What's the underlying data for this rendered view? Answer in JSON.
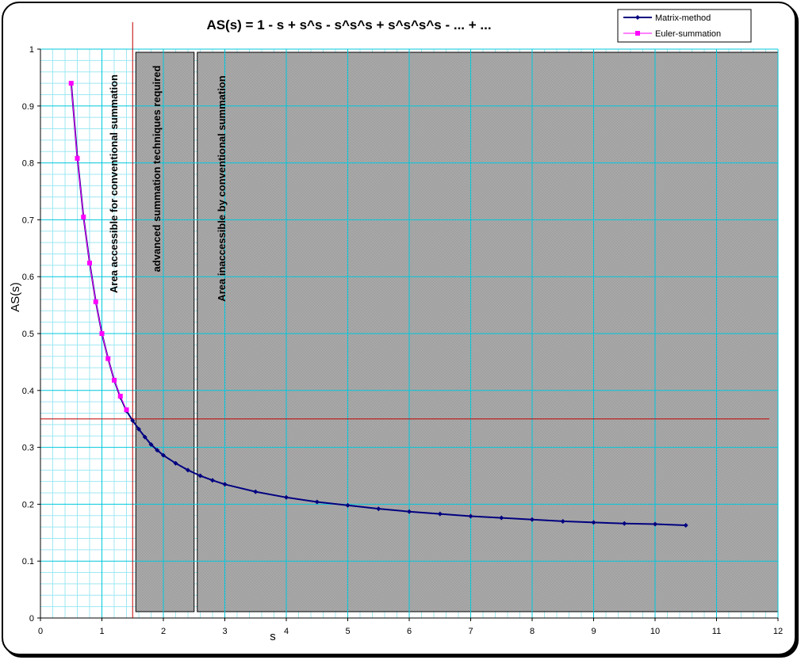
{
  "chart_data": {
    "type": "line",
    "title": "AS(s) = 1 - s + s^s - s^s^s + s^s^s^s - ... + ...",
    "xlabel": "s",
    "ylabel": "AS(s)",
    "xlim": [
      0,
      12
    ],
    "ylim": [
      0,
      1
    ],
    "x_ticks": [
      "0",
      "1",
      "2",
      "3",
      "4",
      "5",
      "6",
      "7",
      "8",
      "9",
      "10",
      "11",
      "12"
    ],
    "y_ticks": [
      "0",
      "0.1",
      "0.2",
      "0.3",
      "0.4",
      "0.5",
      "0.6",
      "0.7",
      "0.8",
      "0.9",
      "1"
    ],
    "grid": true,
    "legend_position": "top-right",
    "series": [
      {
        "name": "Matrix-method",
        "color": "#000080",
        "marker": "diamond",
        "x": [
          0.5,
          0.6,
          0.7,
          0.8,
          0.9,
          1.0,
          1.1,
          1.2,
          1.3,
          1.4,
          1.5,
          1.6,
          1.7,
          1.8,
          1.9,
          2.0,
          2.2,
          2.4,
          2.6,
          2.8,
          3.0,
          3.5,
          4.0,
          4.5,
          5.0,
          5.5,
          6.0,
          6.5,
          7.0,
          7.5,
          8.0,
          8.5,
          9.0,
          9.5,
          10.0,
          10.5
        ],
        "y": [
          0.94,
          0.81,
          0.705,
          0.625,
          0.556,
          0.5,
          0.456,
          0.418,
          0.388,
          0.364,
          0.347,
          0.332,
          0.318,
          0.305,
          0.295,
          0.286,
          0.272,
          0.26,
          0.25,
          0.242,
          0.235,
          0.222,
          0.212,
          0.204,
          0.198,
          0.192,
          0.187,
          0.183,
          0.179,
          0.176,
          0.173,
          0.17,
          0.168,
          0.166,
          0.165,
          0.163
        ]
      },
      {
        "name": "Euler-summation",
        "color": "#ff00ff",
        "marker": "square",
        "x": [
          0.5,
          0.6,
          0.7,
          0.8,
          0.9,
          1.0,
          1.1,
          1.2,
          1.3,
          1.4
        ],
        "y": [
          0.94,
          0.808,
          0.705,
          0.624,
          0.556,
          0.5,
          0.456,
          0.418,
          0.39,
          0.366
        ]
      }
    ],
    "regions": [
      {
        "label": "Area accessible for conventional summation",
        "x_from": 0,
        "x_to": 1.5,
        "shaded": false
      },
      {
        "label": "advanced summation techniques required",
        "x_from": 1.5,
        "x_to": 2.5,
        "shaded": true
      },
      {
        "label": "Area inaccessible by conventional summation",
        "x_from": 2.5,
        "x_to": 12,
        "shaded": true
      }
    ],
    "reference_lines": {
      "vertical_x": 1.5,
      "horizontal_y": 0.35,
      "color": "#c00000"
    }
  }
}
